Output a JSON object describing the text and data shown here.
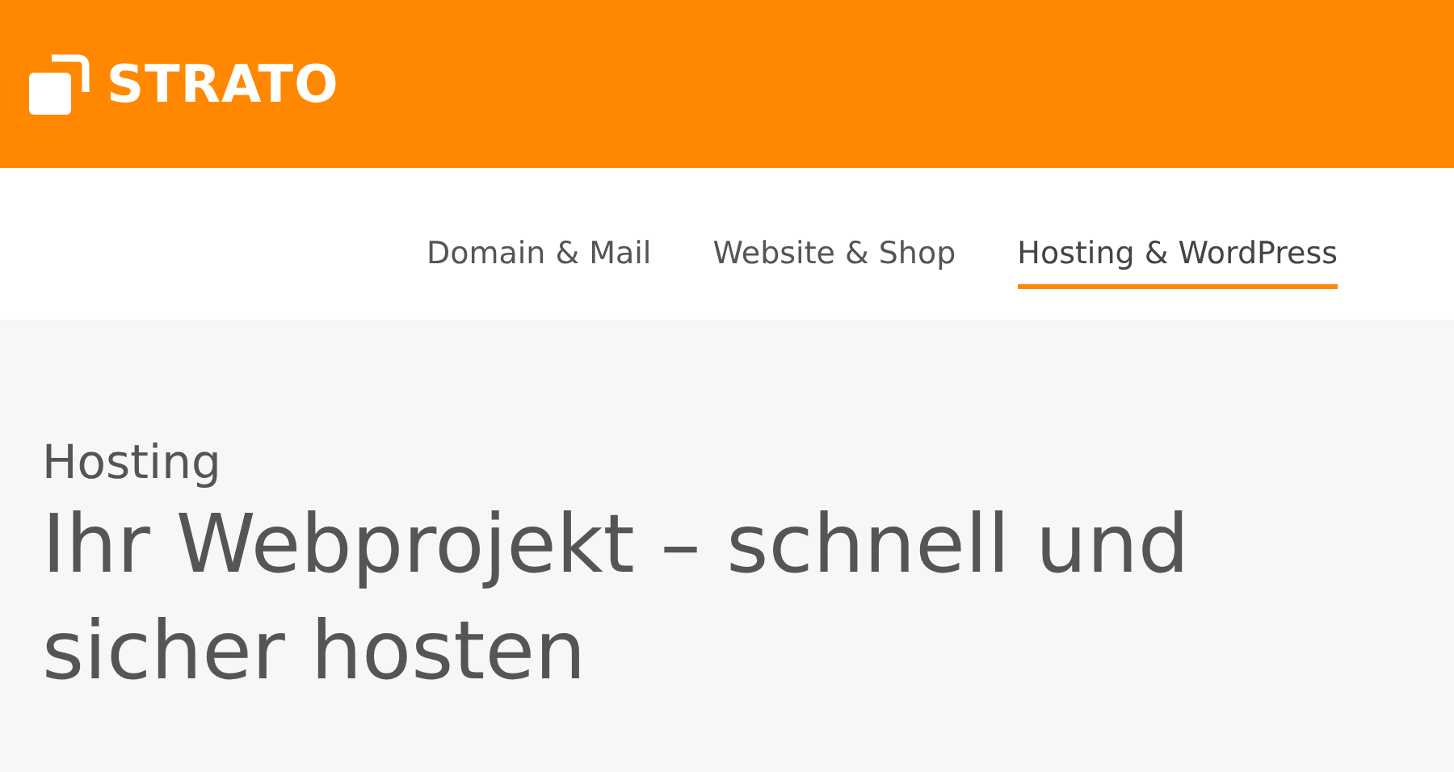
{
  "logo": {
    "text": "STRATO"
  },
  "nav": [
    {
      "label": "Domain & Mail",
      "selected": false
    },
    {
      "label": "Website & Shop",
      "selected": false
    },
    {
      "label": "Hosting & WordPress",
      "selected": true
    }
  ],
  "hero": {
    "eyebrow": "Hosting",
    "headline": "Ihr Webprojekt – schnell und sicher hosten"
  }
}
